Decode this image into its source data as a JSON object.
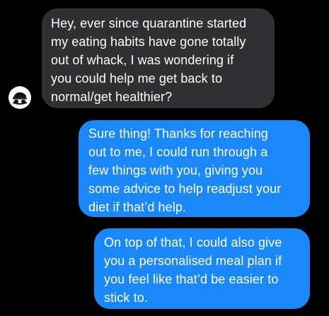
{
  "conversation": {
    "messages": [
      {
        "direction": "incoming",
        "text": "Hey, ever since quarantine started\nmy eating habits have gone totally\nout of whack, I was wondering if\nyou could help me get back to\nnormal/get healthier?"
      },
      {
        "direction": "outgoing",
        "text": "Sure thing! Thanks for reaching\nout to me, I could run through a\nfew things with you, giving you\nsome advice to help readjust your\ndiet if that’d help."
      },
      {
        "direction": "outgoing",
        "text": "On top of that, I could also give\nyou a personalised meal plan if\nyou feel like that’d be easier to\nstick to."
      }
    ],
    "avatar_icon": "profile-avatar-icon"
  },
  "colors": {
    "background": "#000000",
    "incoming_bubble": "#303032",
    "outgoing_bubble": "#1a88f8",
    "text": "#ffffff"
  }
}
